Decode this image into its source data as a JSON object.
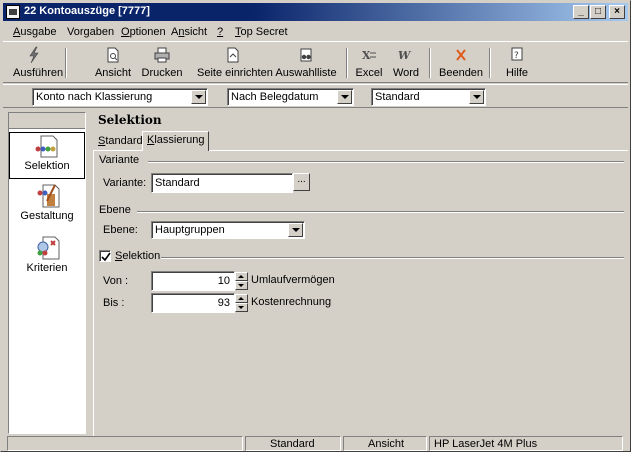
{
  "window": {
    "title": "22 Kontoauszüge [7777]",
    "controls": {
      "minimize": "_",
      "maximize": "□",
      "close": "×"
    }
  },
  "menubar": [
    {
      "label_u": "A",
      "label_rest": "usgabe"
    },
    {
      "label_pre": "Vor",
      "label_u": "g",
      "label_rest": "aben"
    },
    {
      "label_u": "O",
      "label_rest": "ptionen"
    },
    {
      "label_pre": "A",
      "label_u": "n",
      "label_rest": "sicht"
    },
    {
      "label_u": "?",
      "label_rest": ""
    },
    {
      "label_u": "T",
      "label_rest": "op Secret"
    }
  ],
  "toolbar": {
    "run": "Ausführen",
    "preview": "Ansicht",
    "print": "Drucken",
    "page_setup": "Seite einrichten",
    "select_list": "Auswahlliste",
    "excel": "Excel",
    "word": "Word",
    "exit": "Beenden",
    "help": "Hilfe"
  },
  "selectors": {
    "account_order": "Konto nach Klassierung",
    "sort": "Nach Belegdatum",
    "layout": "Standard"
  },
  "nav": {
    "items": [
      "Selektion",
      "Gestaltung",
      "Kriterien"
    ],
    "active": "Selektion",
    "icons": [
      "selection-icon",
      "design-icon",
      "criteria-icon"
    ]
  },
  "panel": {
    "title": "Selektion",
    "tabs": [
      {
        "label_u": "S",
        "label_rest": "tandard"
      },
      {
        "label_u": "K",
        "label_rest": "lassierung"
      }
    ],
    "active_tab": "Klassierung",
    "variant_group": "Variante",
    "variant_label": "Variante:",
    "variant_value": "Standard",
    "browse_label": "...",
    "level_group": "Ebene",
    "level_label": "Ebene:",
    "level_value": "Hauptgruppen",
    "selection_u": "S",
    "selection_rest": "elektion",
    "selection_checked": true,
    "from_label": "Von :",
    "from_value": "10",
    "from_desc": "Umlaufvermögen",
    "to_label": "Bis :",
    "to_value": "93",
    "to_desc": "Kostenrechnung"
  },
  "statusbar": {
    "left": "",
    "layout": "Standard",
    "view": "Ansicht",
    "printer": "HP LaserJet 4M Plus"
  },
  "colors": {
    "face": "#d4d0c8",
    "titlebar_start": "#0a246a",
    "titlebar_end": "#a6caf0",
    "close_x": "#e05a1a"
  }
}
